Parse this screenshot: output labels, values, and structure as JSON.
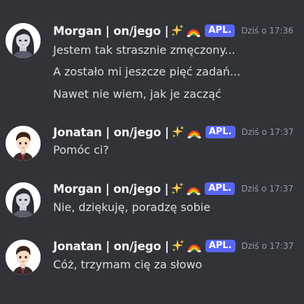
{
  "colors": {
    "background": "#313338",
    "username": "#f2f3f5",
    "message_text": "#dbdee1",
    "timestamp": "#949ba4",
    "badge_bg": "#5865f2"
  },
  "messages": [
    {
      "author": "Morgan | on/jego |",
      "avatar": "morgan-avatar",
      "emojis": [
        "sparkles-icon",
        "rainbow-icon"
      ],
      "badge": "APL.",
      "timestamp": "Dziś o 17:36",
      "lines": [
        "Jestem tak strasznie zmęczony...",
        "A zostało mi jeszcze pięć zadań...",
        "Nawet nie wiem, jak je zacząć"
      ]
    },
    {
      "author": "Jonatan | on/jego |",
      "avatar": "jonatan-avatar",
      "emojis": [
        "sparkles-icon",
        "rainbow-icon"
      ],
      "badge": "APL.",
      "timestamp": "Dziś o 17:37",
      "lines": [
        "Pomóc ci?"
      ]
    },
    {
      "author": "Morgan | on/jego |",
      "avatar": "morgan-avatar",
      "emojis": [
        "sparkles-icon",
        "rainbow-icon"
      ],
      "badge": "APL.",
      "timestamp": "Dziś o 17:37",
      "lines": [
        "Nie, dziękuję, poradzę sobie"
      ]
    },
    {
      "author": "Jonatan | on/jego |",
      "avatar": "jonatan-avatar",
      "emojis": [
        "sparkles-icon",
        "rainbow-icon"
      ],
      "badge": "APL.",
      "timestamp": "Dziś o 17:37",
      "lines": [
        "Cóż, trzymam cię za słowo"
      ]
    }
  ]
}
